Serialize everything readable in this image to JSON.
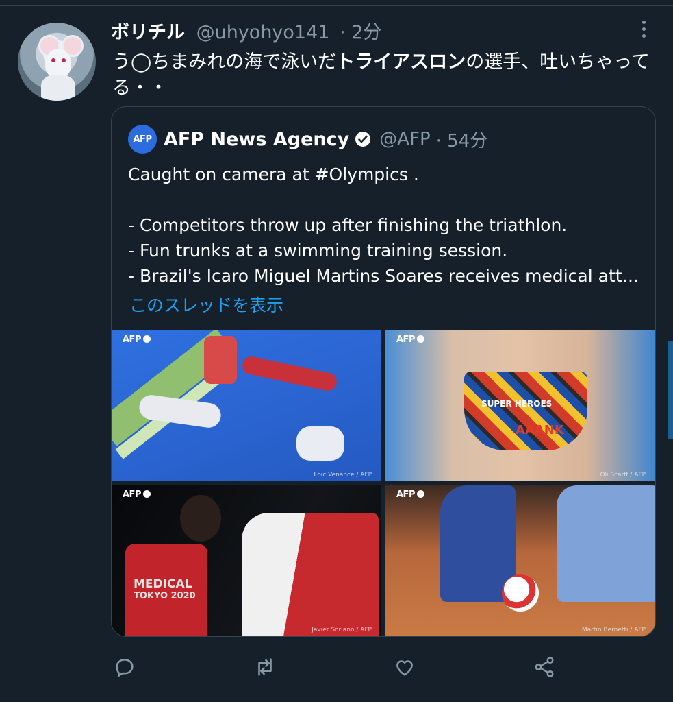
{
  "tweet": {
    "author_name": "ボリチル",
    "author_handle": "@uhyohyo141",
    "time": "· 2分",
    "text_part1": "う◯ちまみれの海で泳いだ",
    "text_bold": "トライアスロン",
    "text_part2": "の選手、吐いちゃってる・・"
  },
  "quote": {
    "author_name": "AFP News Agency",
    "author_handle": "@AFP",
    "time": "· 54分",
    "logo_text": "AFP",
    "lines": [
      "Caught on camera at #Olympics   .",
      "- Competitors throw up after finishing the triathlon.",
      "- Fun trunks at a swimming training session.",
      "- Brazil's Icaro Miguel Martins Soares receives medical att…"
    ],
    "thread_link": "このスレッドを表示"
  },
  "photos": [
    {
      "tag": "AFP",
      "credit": "Loic Venance / AFP"
    },
    {
      "tag": "AFP",
      "credit": "Oli Scarff / AFP",
      "trunks_text": [
        "SUPER HEROES",
        "AAANK"
      ]
    },
    {
      "tag": "AFP",
      "credit": "Javier Soriano / AFP",
      "vest_text": [
        "MEDICAL",
        "TOKYO 2020"
      ]
    },
    {
      "tag": "AFP",
      "credit": "Martin Bernetti / AFP"
    }
  ],
  "actions": [
    "reply-icon",
    "retweet-icon",
    "like-icon",
    "share-icon"
  ],
  "colors": {
    "background": "#15202b",
    "muted": "#8899a6",
    "link": "#1da1f2",
    "afp_blue": "#2d6cdf",
    "border": "#38444d"
  }
}
